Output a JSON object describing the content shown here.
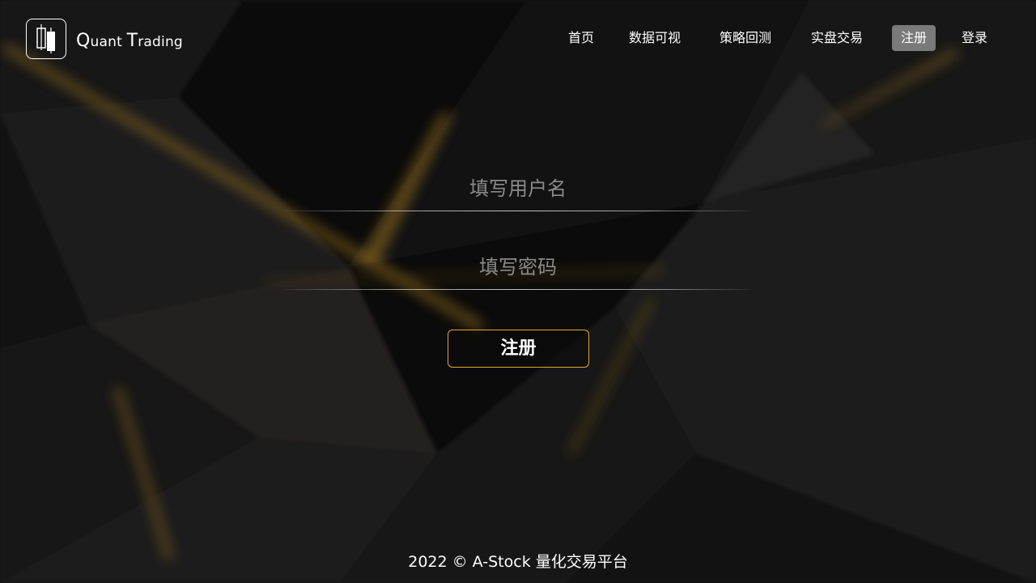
{
  "brand": {
    "logo_icon": "candlestick-icon",
    "name_first_cap": "Q",
    "name_first_rest": "uant",
    "name_second_cap": "T",
    "name_second_rest": "rading"
  },
  "nav": {
    "items": [
      {
        "label": "首页"
      },
      {
        "label": "数据可视"
      },
      {
        "label": "策略回测"
      },
      {
        "label": "实盘交易"
      },
      {
        "label": "注册"
      },
      {
        "label": "登录"
      }
    ],
    "active": "注册"
  },
  "form": {
    "username_placeholder": "填写用户名",
    "password_placeholder": "填写密码",
    "submit_label": "注册"
  },
  "footer": {
    "text": "2022 © A-Stock 量化交易平台"
  },
  "colors": {
    "accent_gold": "#e0a82e",
    "active_nav_bg": "#7a7a7a",
    "background": "#141414"
  }
}
